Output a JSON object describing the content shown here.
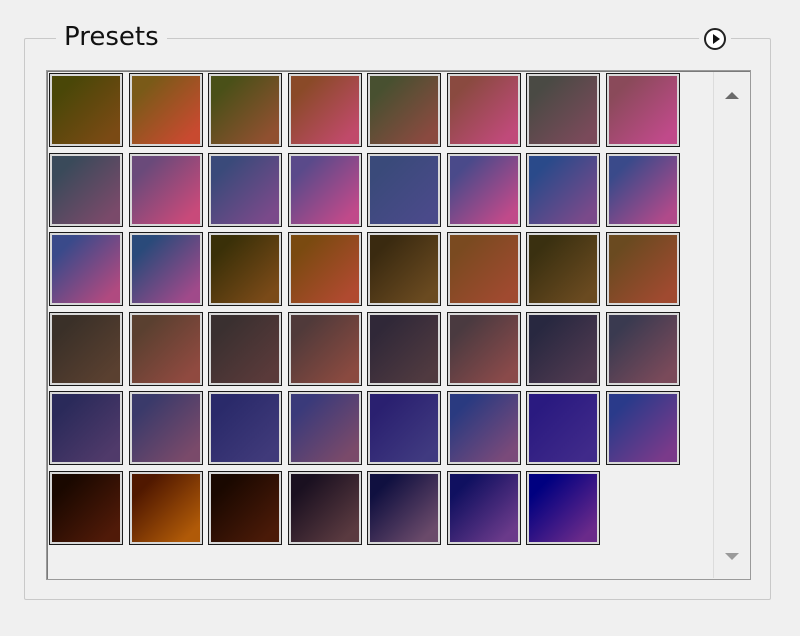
{
  "panel": {
    "title": "Presets",
    "menu_icon": "circle-arrow-right-icon",
    "scroll_up_icon": "scroll-up-arrow-icon",
    "scroll_down_icon": "scroll-down-arrow-icon"
  },
  "presets": [
    [
      "#4a4708",
      "#7a4a14"
    ],
    [
      "#7a5a18",
      "#c84a30"
    ],
    [
      "#4a5018",
      "#905030"
    ],
    [
      "#8a4a28",
      "#c04a6a"
    ],
    [
      "#485030",
      "#8a4a40"
    ],
    [
      "#8a4a40",
      "#c04a7a"
    ],
    [
      "#4a4a44",
      "#7a4a5a"
    ],
    [
      "#8a4a5a",
      "#c04a8a"
    ],
    [
      "#3a4a5a",
      "#7a4a6a"
    ],
    [
      "#6a4a7a",
      "#c84a7a"
    ],
    [
      "#3a4a7a",
      "#7a4a8a"
    ],
    [
      "#5a4a8a",
      "#c04a8a"
    ],
    [
      "#3a4a7a",
      "#4a4a8a"
    ],
    [
      "#4a4a8a",
      "#c04a8a"
    ],
    [
      "#2a4a8a",
      "#7a4a8a"
    ],
    [
      "#3a4a8a",
      "#b04a8a"
    ],
    [
      "#3a4a8a",
      "#b04a80"
    ],
    [
      "#2a4a7a",
      "#a04a8a"
    ],
    [
      "#3a3008",
      "#7a4a18"
    ],
    [
      "#7a4a10",
      "#b04a30"
    ],
    [
      "#3a2a10",
      "#6a4a20"
    ],
    [
      "#7a4a20",
      "#a04a30"
    ],
    [
      "#3a3010",
      "#6a4a20"
    ],
    [
      "#6a4a20",
      "#a04a30"
    ],
    [
      "#3a3028",
      "#5a4030"
    ],
    [
      "#5a4030",
      "#904a40"
    ],
    [
      "#3a3030",
      "#5a3a3a"
    ],
    [
      "#503a3a",
      "#8a4a40"
    ],
    [
      "#302838",
      "#503a40"
    ],
    [
      "#4a3a40",
      "#8a4a4a"
    ],
    [
      "#282840",
      "#503a50"
    ],
    [
      "#3a3a50",
      "#7a4a5a"
    ],
    [
      "#2a2a5a",
      "#503a6a"
    ],
    [
      "#3a3a6a",
      "#7a4a6a"
    ],
    [
      "#2a2a6a",
      "#403a7a"
    ],
    [
      "#3a3a7a",
      "#7a4a6a"
    ],
    [
      "#2a2070",
      "#403a80"
    ],
    [
      "#2a3a80",
      "#7a4a7a"
    ],
    [
      "#2a1a80",
      "#402a8a"
    ],
    [
      "#2a3a8a",
      "#7a3a8a"
    ],
    [
      "#1a0800",
      "#501a08"
    ],
    [
      "#501800",
      "#b05a08"
    ],
    [
      "#1a0800",
      "#4a1a08"
    ],
    [
      "#1a1020",
      "#5a3a40"
    ],
    [
      "#101040",
      "#6a4a6a"
    ],
    [
      "#101060",
      "#6a3a8a"
    ],
    [
      "#000080",
      "#6a2a8a"
    ]
  ]
}
